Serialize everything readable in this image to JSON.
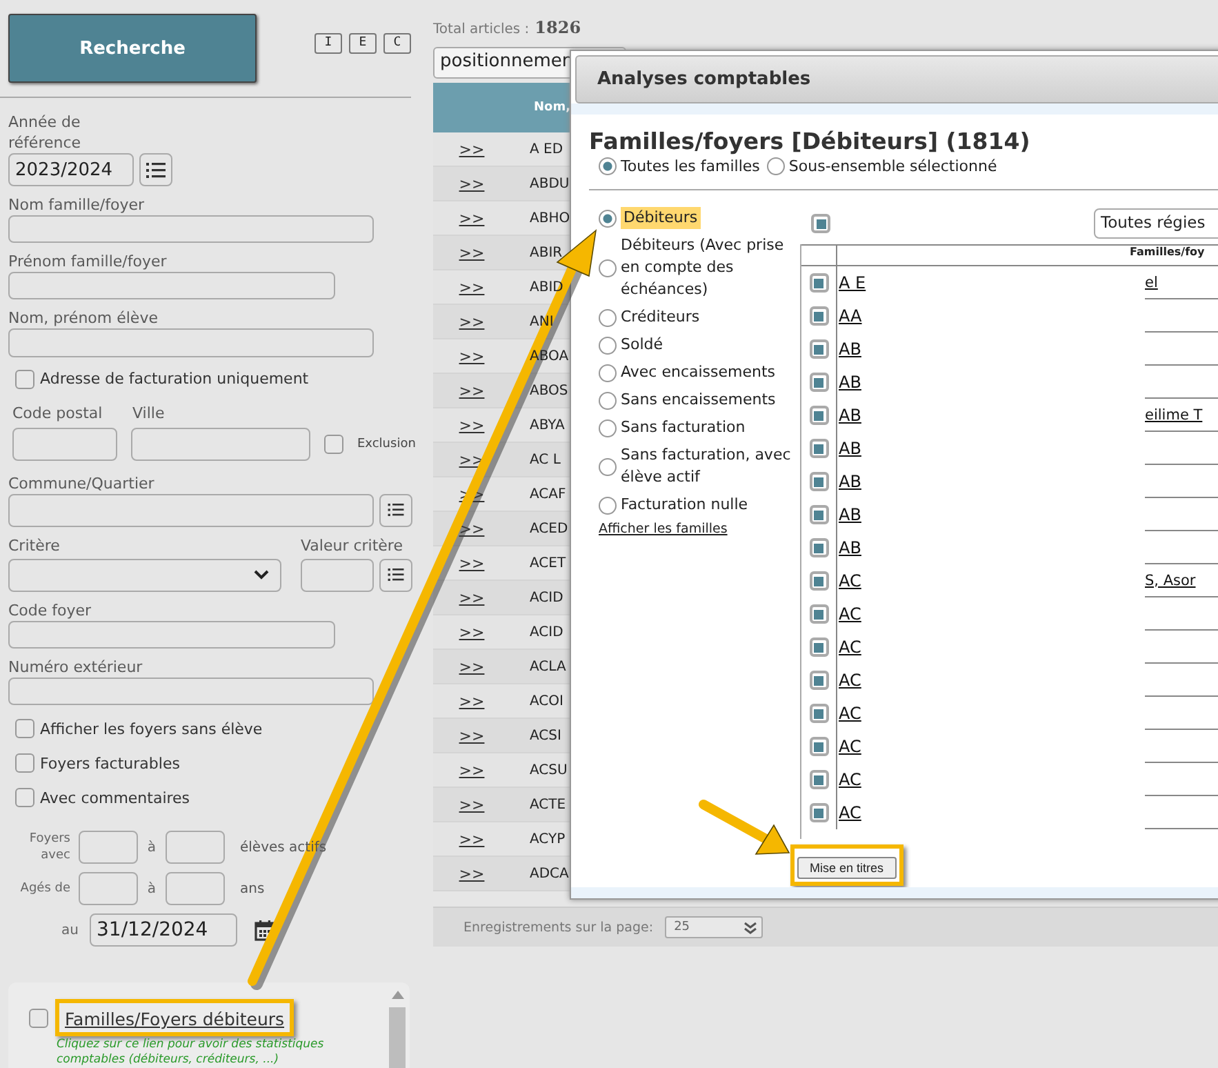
{
  "search_form": {
    "search_button": "Recherche",
    "mode_buttons": [
      "I",
      "E",
      "C"
    ],
    "year": {
      "label": "Année de référence",
      "value": "2023/2024"
    },
    "family_name": {
      "label": "Nom famille/foyer"
    },
    "family_firstname": {
      "label": "Prénom famille/foyer"
    },
    "student_name": {
      "label": "Nom, prénom élève"
    },
    "billing_address_only": {
      "label": "Adresse de facturation uniquement",
      "checked": false
    },
    "postal_code": {
      "label": "Code postal"
    },
    "city": {
      "label": "Ville"
    },
    "exclusion": {
      "label": "Exclusion",
      "checked": false
    },
    "district": {
      "label": "Commune/Quartier"
    },
    "criterion": {
      "label": "Critère"
    },
    "criterion_value": {
      "label": "Valeur critère"
    },
    "household_code": {
      "label": "Code foyer"
    },
    "external_number": {
      "label": "Numéro extérieur"
    },
    "options": [
      {
        "label": "Afficher les foyers sans élève",
        "checked": false
      },
      {
        "label": "Foyers facturables",
        "checked": false
      },
      {
        "label": "Avec commentaires",
        "checked": false
      }
    ],
    "ranges": [
      {
        "label": "Foyers avec",
        "between": "à",
        "unit": "élèves actifs"
      },
      {
        "label": "Agés de",
        "between": "à",
        "unit": "ans"
      }
    ],
    "reference_date": {
      "label": "au",
      "value": "31/12/2024"
    },
    "stat_links": [
      {
        "label": "Familles/Foyers débiteurs",
        "checked": false,
        "highlighted": true,
        "hint": "Cliquez sur ce lien pour avoir des statistiques comptables (débiteurs, créditeurs, ...)"
      }
    ]
  },
  "results": {
    "total_label": "Total articles :",
    "total": "1826",
    "sort_select": "positionnemen",
    "columns": [
      "Nom,"
    ],
    "rows": [
      {
        "link": ">>",
        "name": "A ED"
      },
      {
        "link": ">>",
        "name": "ABDU"
      },
      {
        "link": ">>",
        "name": "ABHO"
      },
      {
        "link": ">>",
        "name": "ABIR"
      },
      {
        "link": ">>",
        "name": "ABID"
      },
      {
        "link": ">>",
        "name": "ANI"
      },
      {
        "link": ">>",
        "name": "ABOA"
      },
      {
        "link": ">>",
        "name": "ABOS"
      },
      {
        "link": ">>",
        "name": "ABYA"
      },
      {
        "link": ">>",
        "name": "AC L"
      },
      {
        "link": ">>",
        "name": "ACAF"
      },
      {
        "link": ">>",
        "name": "ACED"
      },
      {
        "link": ">>",
        "name": "ACET"
      },
      {
        "link": ">>",
        "name": "ACID"
      },
      {
        "link": ">>",
        "name": "ACID"
      },
      {
        "link": ">>",
        "name": "ACLA"
      },
      {
        "link": ">>",
        "name": "ACOI"
      },
      {
        "link": ">>",
        "name": "ACSI"
      },
      {
        "link": ">>",
        "name": "ACSU"
      },
      {
        "link": ">>",
        "name": "ACTE"
      },
      {
        "link": ">>",
        "name": "ACYP"
      },
      {
        "link": ">>",
        "name": "ADCA"
      }
    ],
    "pager_label": "Enregistrements sur la page:",
    "page_size": "25"
  },
  "modal": {
    "title": "Analyses comptables",
    "heading": "Familles/foyers [Débiteurs] (1814)",
    "scopes": [
      {
        "label": "Toutes les familles",
        "selected": true
      },
      {
        "label": "Sous-ensemble sélectionné",
        "selected": false
      }
    ],
    "filters": [
      {
        "label": "Débiteurs",
        "selected": true,
        "highlighted": true
      },
      {
        "label": "Débiteurs (Avec prise en compte des échéances)",
        "selected": false,
        "highlighted": false
      },
      {
        "label": "Créditeurs",
        "selected": false,
        "highlighted": false
      },
      {
        "label": "Soldé",
        "selected": false,
        "highlighted": false
      },
      {
        "label": "Avec encaissements",
        "selected": false,
        "highlighted": false
      },
      {
        "label": "Sans encaissements",
        "selected": false,
        "highlighted": false
      },
      {
        "label": "Sans facturation",
        "selected": false,
        "highlighted": false
      },
      {
        "label": "Sans facturation, avec élève actif",
        "selected": false,
        "highlighted": false
      },
      {
        "label": "Facturation nulle",
        "selected": false,
        "highlighted": false
      }
    ],
    "show_link": "Afficher les familles",
    "select_all": {
      "checked": true
    },
    "regie_select": "Toutes régies",
    "column": "Familles/foy",
    "rows": [
      {
        "checked": true,
        "name": "A E",
        "extra": "el"
      },
      {
        "checked": true,
        "name": "AA"
      },
      {
        "checked": true,
        "name": "AB"
      },
      {
        "checked": true,
        "name": "AB"
      },
      {
        "checked": true,
        "name": "AB",
        "extra": "eilime T"
      },
      {
        "checked": true,
        "name": "AB"
      },
      {
        "checked": true,
        "name": "AB"
      },
      {
        "checked": true,
        "name": "AB"
      },
      {
        "checked": true,
        "name": "AB"
      },
      {
        "checked": true,
        "name": "AC",
        "extra": "S, Asor"
      },
      {
        "checked": true,
        "name": "AC"
      },
      {
        "checked": true,
        "name": "AC"
      },
      {
        "checked": true,
        "name": "AC"
      },
      {
        "checked": true,
        "name": "AC"
      },
      {
        "checked": true,
        "name": "AC"
      },
      {
        "checked": true,
        "name": "AC"
      },
      {
        "checked": true,
        "name": "AC"
      }
    ],
    "button": {
      "label": "Mise en titres",
      "highlighted": true
    }
  }
}
